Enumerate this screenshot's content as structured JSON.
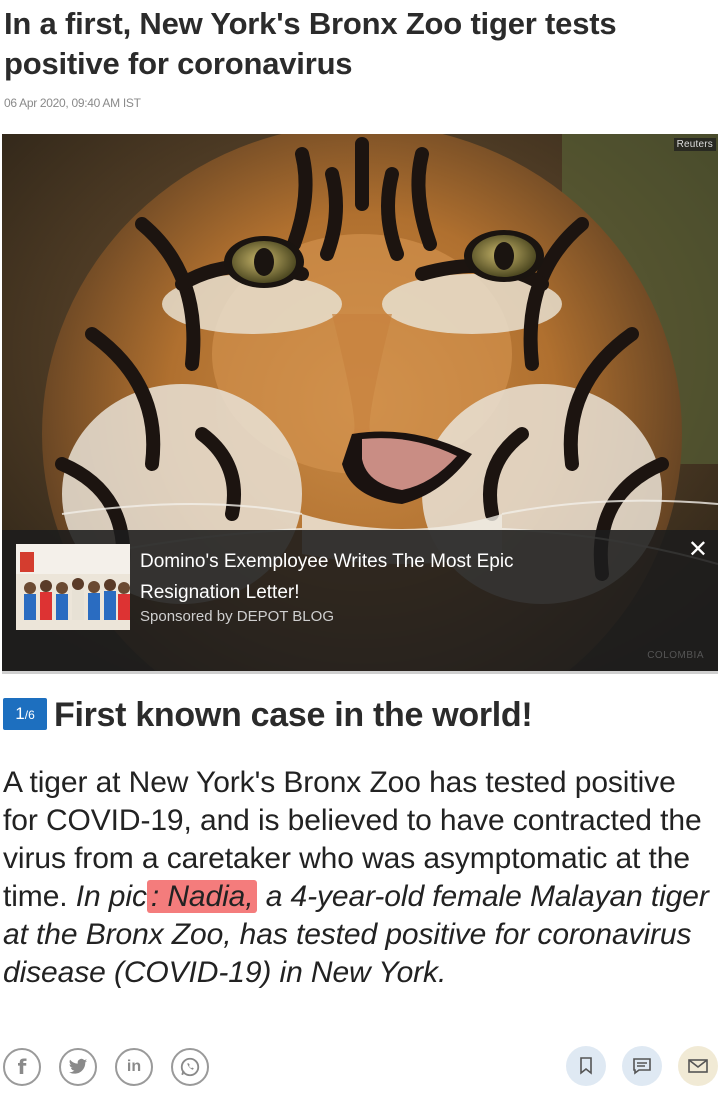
{
  "article": {
    "headline": "In a first, New York's Bronx Zoo tiger tests positive for coronavirus",
    "dateline": "06 Apr 2020, 09:40 AM IST"
  },
  "photo": {
    "credit": "Reuters",
    "watermark": "COLOMBIA"
  },
  "ad": {
    "title": "Domino's Exemployee Writes The Most Epic Resignation Letter!",
    "sponsor": "Sponsored by DEPOT BLOG",
    "close": "✕"
  },
  "slide": {
    "current": "1",
    "total": "6",
    "title": "First known case in the world!"
  },
  "caption": {
    "plain": "A tiger at New York's Bronx Zoo has tested positive for COVID-19, and is believed to have contracted the virus from a caretaker who was asymptomatic at the time. ",
    "italic_before": "In pic",
    "italic_highlight": ": Nadia,",
    "italic_after": " a 4-year-old female Malayan tiger at the Bronx Zoo, has tested positive for coronavirus disease (COVID-19) in New York."
  },
  "share_icons": [
    "facebook-icon",
    "twitter-icon",
    "linkedin-icon",
    "whatsapp-icon"
  ],
  "share_glyphs": {
    "facebook": "f",
    "twitter": "🐦",
    "linkedin": "in",
    "whatsapp": "☏"
  },
  "action_icons": [
    "bookmark-icon",
    "comment-icon",
    "email-icon"
  ],
  "colors": {
    "badge": "#1d6fbf",
    "highlight": "#f05050",
    "bookmark_bg": "#dfe9f3",
    "comment_bg": "#dfe9f3",
    "email_bg": "#f1ead5"
  }
}
